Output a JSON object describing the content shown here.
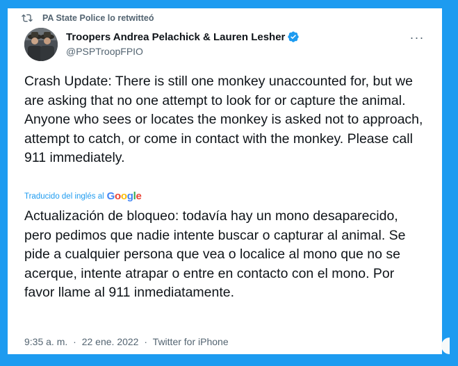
{
  "colors": {
    "background": "#1d9bf0",
    "card": "#ffffff",
    "text": "#0f1419",
    "muted": "#536471",
    "link": "#1d9bf0",
    "verified": "#1d9bf0"
  },
  "retweet": {
    "icon": "retweet-icon",
    "label": "PA State Police lo retwitteó"
  },
  "author": {
    "name": "Troopers Andrea Pelachick & Lauren Lesher",
    "handle": "@PSPTroopFPIO",
    "verified_icon": "verified-badge-icon",
    "avatar_icon": "avatar-troopers"
  },
  "more_icon": "more-options-icon",
  "more_label": "···",
  "tweet": {
    "text": "Crash Update: There is still one monkey unaccounted for, but we are asking that no one attempt to look for or capture the animal. Anyone who sees or locates the monkey is asked not to approach, attempt to catch, or come in contact with the monkey. Please call 911 immediately.",
    "translated_label": "Traducido del inglés al",
    "translator": "Google",
    "translation": "Actualización de bloqueo: todavía hay un mono desaparecido, pero pedimos que nadie intente buscar o capturar al animal. Se pide a cualquier persona que vea o localice al mono que no se acerque, intente atrapar o entre en contacto con el mono. Por favor llame al 911 inmediatamente."
  },
  "meta": {
    "time": "9:35 a. m.",
    "separator": "·",
    "date": "22 ene. 2022",
    "source": "Twitter for iPhone"
  }
}
